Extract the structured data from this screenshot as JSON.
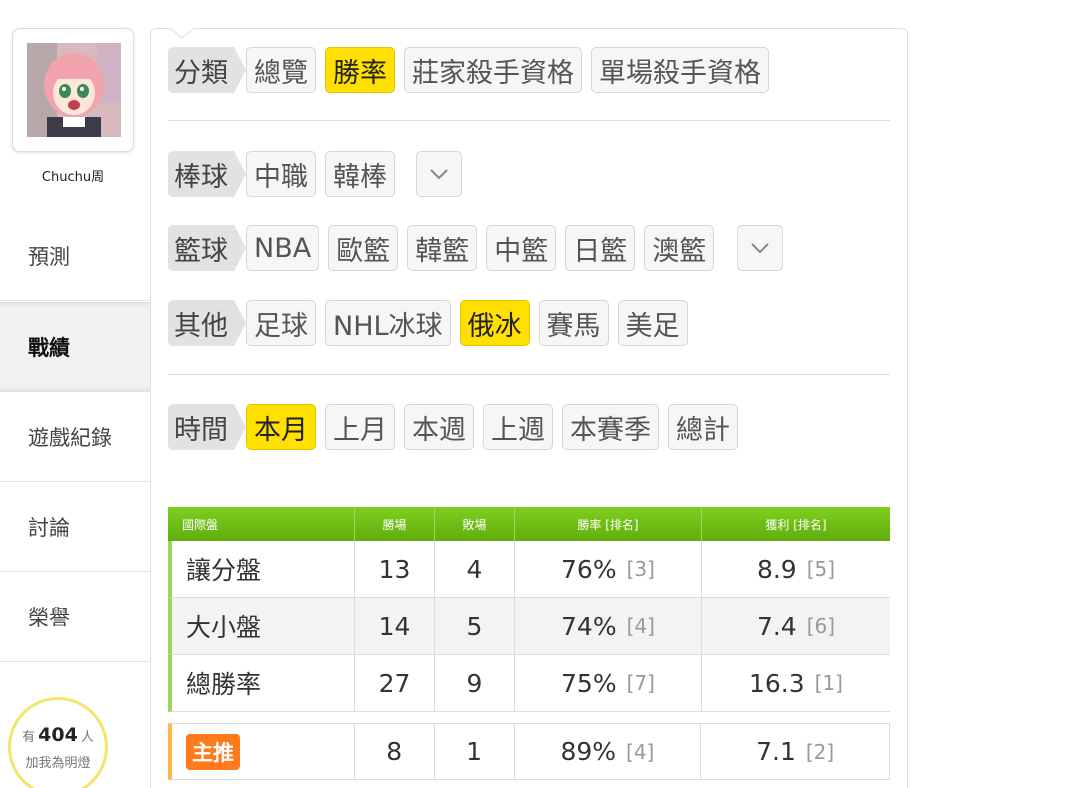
{
  "sidebar": {
    "username": "Chuchu周",
    "items": [
      {
        "label": "預測"
      },
      {
        "label": "戰績"
      },
      {
        "label": "遊戲紀錄"
      },
      {
        "label": "討論"
      },
      {
        "label": "榮譽"
      }
    ],
    "fans": {
      "prefix": "有",
      "count": "404",
      "suffix": "人",
      "caption": "加我為明燈"
    }
  },
  "filters": {
    "category": {
      "label": "分類",
      "options": [
        "總覽",
        "勝率",
        "莊家殺手資格",
        "單場殺手資格"
      ],
      "selected": "勝率"
    },
    "baseball": {
      "label": "棒球",
      "options": [
        "中職",
        "韓棒"
      ]
    },
    "basketball": {
      "label": "籃球",
      "options": [
        "NBA",
        "歐籃",
        "韓籃",
        "中籃",
        "日籃",
        "澳籃"
      ]
    },
    "other": {
      "label": "其他",
      "options": [
        "足球",
        "NHL冰球",
        "俄冰",
        "賽馬",
        "美足"
      ],
      "selected": "俄冰"
    },
    "time": {
      "label": "時間",
      "options": [
        "本月",
        "上月",
        "本週",
        "上週",
        "本賽季",
        "總計"
      ],
      "selected": "本月"
    }
  },
  "table": {
    "headers": [
      "國際盤",
      "勝場",
      "敗場",
      "勝率 [排名]",
      "獲利 [排名]"
    ],
    "rows": [
      {
        "name": "讓分盤",
        "win": "13",
        "lose": "4",
        "rate": "76%",
        "rate_rank": "[3]",
        "profit": "8.9",
        "profit_rank": "[5]"
      },
      {
        "name": "大小盤",
        "win": "14",
        "lose": "5",
        "rate": "74%",
        "rate_rank": "[4]",
        "profit": "7.4",
        "profit_rank": "[6]"
      },
      {
        "name": "總勝率",
        "win": "27",
        "lose": "9",
        "rate": "75%",
        "rate_rank": "[7]",
        "profit": "16.3",
        "profit_rank": "[1]"
      }
    ],
    "pick": {
      "name": "主推",
      "win": "8",
      "lose": "1",
      "rate": "89%",
      "rate_rank": "[4]",
      "profit": "7.1",
      "profit_rank": "[2]"
    }
  },
  "colors": {
    "selected_chip": "#ffe000",
    "table_header": "#6cbd14",
    "pick_badge": "#ff7a1a",
    "fans_ring": "#f2e56a"
  }
}
